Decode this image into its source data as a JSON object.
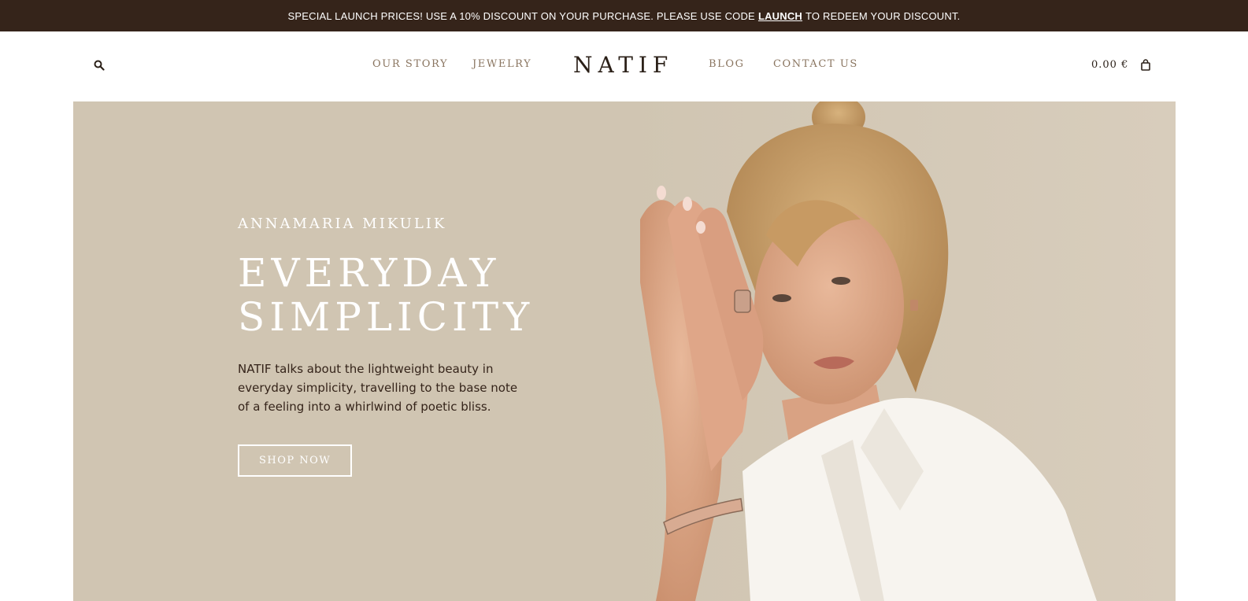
{
  "announcement": {
    "text_before": "SPECIAL LAUNCH PRICES! USE A 10% DISCOUNT ON YOUR PURCHASE. PLEASE USE CODE",
    "code": "LAUNCH",
    "text_after": "TO REDEEM YOUR DISCOUNT."
  },
  "header": {
    "search_icon": "search-icon",
    "nav_left": [
      {
        "label": "OUR STORY"
      },
      {
        "label": "JEWELRY"
      }
    ],
    "logo": "NATIF",
    "nav_right": [
      {
        "label": "BLOG"
      },
      {
        "label": "CONTACT US"
      }
    ],
    "cart_total": "0.00 €",
    "cart_icon": "shopping-bag-icon"
  },
  "hero": {
    "eyebrow": "ANNAMARIA MIKULIK",
    "title_line1": "EVERYDAY",
    "title_line2": "SIMPLICITY",
    "description": "NATIF talks about the lightweight beauty in everyday simplicity, travelling to the base note of a feeling into a whirlwind of poetic bliss.",
    "cta_label": "SHOP NOW",
    "image": "model-portrait-with-rings-and-bracelet"
  },
  "colors": {
    "announcement_bg": "#35241a",
    "hero_bg": "#d0c5b2",
    "nav_text": "#8a7560",
    "dark_text": "#2b2018"
  }
}
